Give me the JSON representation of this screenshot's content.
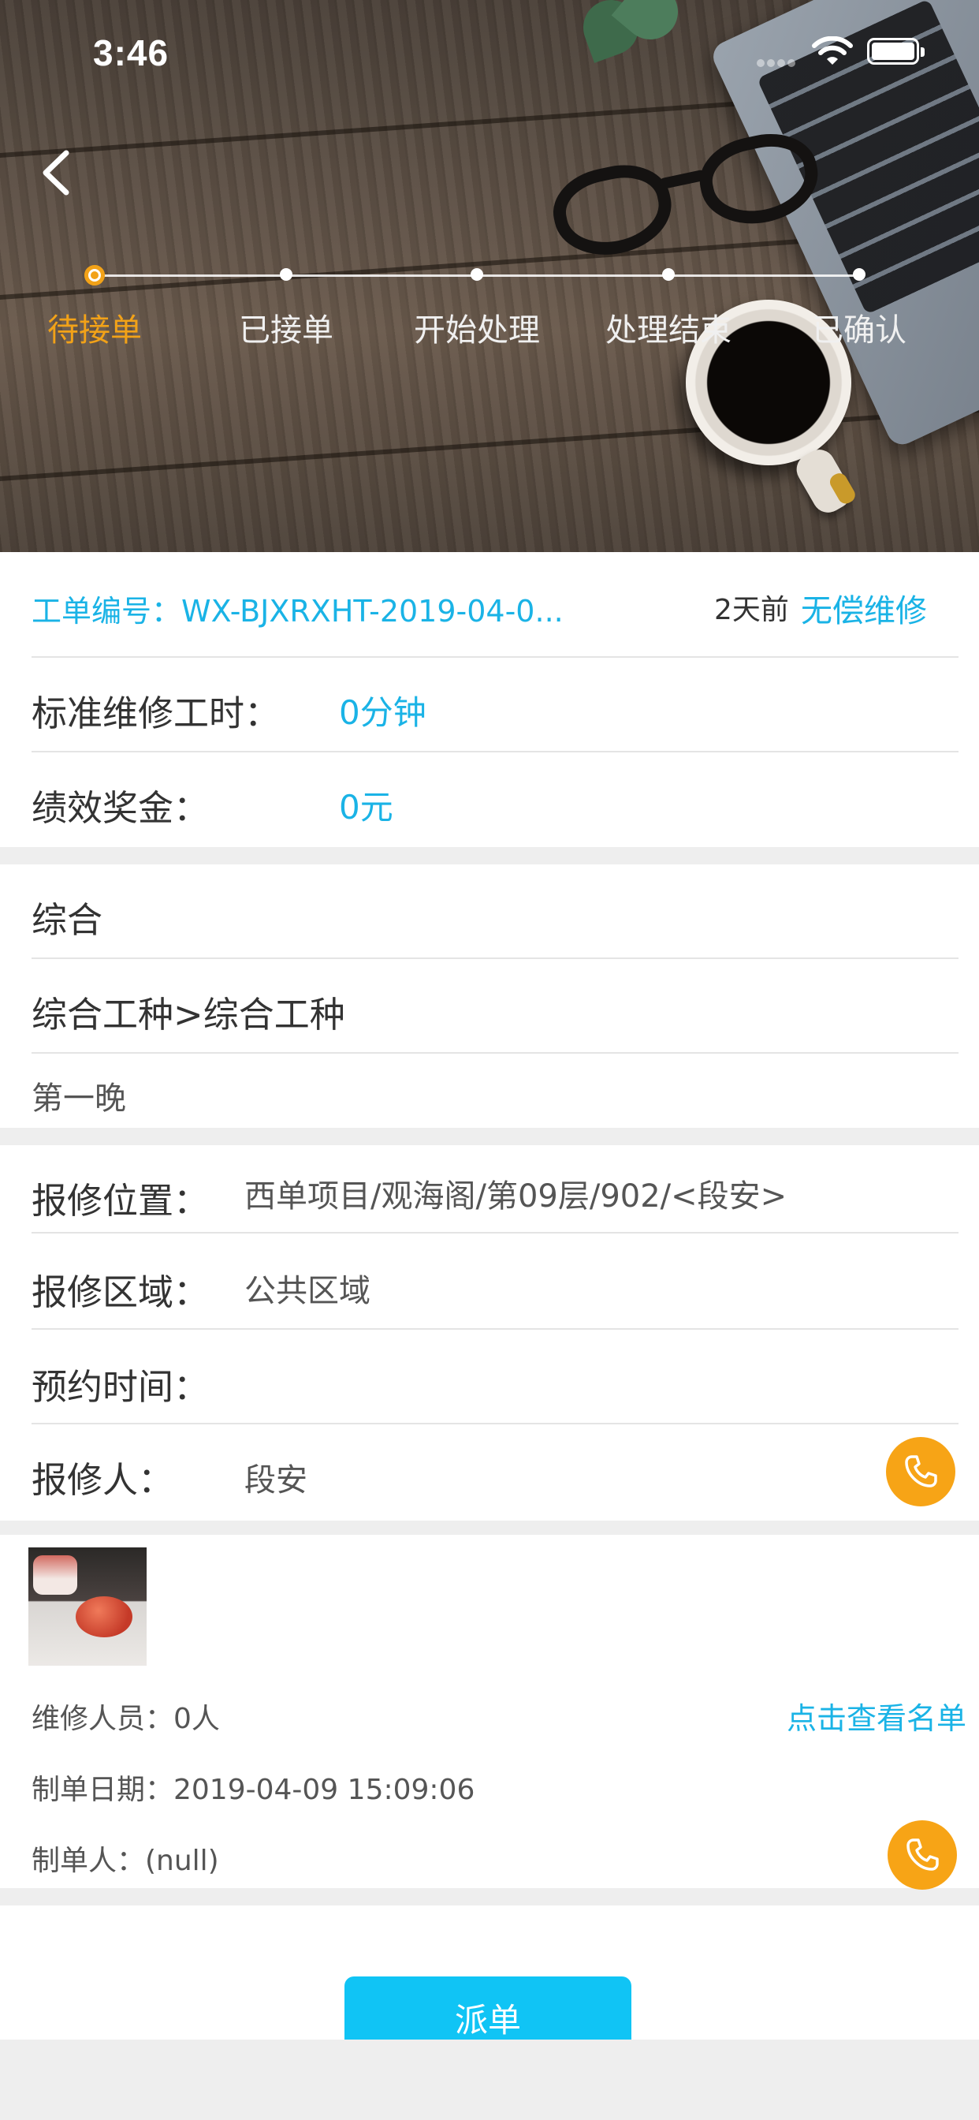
{
  "status_bar": {
    "time": "3:46"
  },
  "steps": [
    "待接单",
    "已接单",
    "开始处理",
    "处理结束",
    "已确认"
  ],
  "active_step": 0,
  "order": {
    "number_label": "工单编号：WX-BJXRXHT-2019-04-0...",
    "age": "2天前",
    "type": "无偿维修"
  },
  "work": {
    "std_hours_label": "标准维修工时：",
    "std_hours_value": "0分钟",
    "bonus_label": "绩效奖金：",
    "bonus_value": "0元"
  },
  "category": {
    "main": "综合",
    "sub": "综合工种>综合工种",
    "desc": "第一晚"
  },
  "repair": {
    "location_label": "报修位置：",
    "location_value": "西单项目/观海阁/第09层/902/<段安>",
    "area_label": "报修区域：",
    "area_value": "公共区域",
    "appointment_label": "预约时间：",
    "appointment_value": "",
    "reporter_label": "报修人：",
    "reporter_value": "段安"
  },
  "details": {
    "staff": "维修人员：0人",
    "view_list": "点击查看名单",
    "created_date": "制单日期：2019-04-09 15:09:06",
    "creator": "制单人：(null)"
  },
  "actions": {
    "dispatch": "派单"
  },
  "colors": {
    "accent": "#1ab3e6",
    "active_step": "#f2a218",
    "phone": "#f7a416",
    "button": "#10c4f5"
  }
}
